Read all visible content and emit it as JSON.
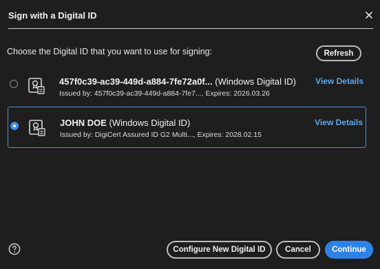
{
  "dialog": {
    "title": "Sign with a Digital ID",
    "close_icon": "close-icon"
  },
  "prompt": "Choose the Digital ID that you want to use for signing:",
  "refresh_label": "Refresh",
  "ids": [
    {
      "name": "457f0c39-ac39-449d-a884-7fe72a0f...",
      "kind": "(Windows Digital ID)",
      "issued": "Issued by: 457f0c39-ac39-449d-a884-7fe7..., Expires: 2026.03.26",
      "view_details": "View Details",
      "selected": false
    },
    {
      "name": "JOHN DOE",
      "kind": "(Windows Digital ID)",
      "issued": "Issued by: DigiCert Assured ID G2 Multi..., Expires: 2028.02.15",
      "view_details": "View Details",
      "selected": true
    }
  ],
  "footer": {
    "help_icon": "help-icon",
    "configure_label": "Configure New Digital ID",
    "cancel_label": "Cancel",
    "continue_label": "Continue"
  },
  "colors": {
    "background": "#1e1e1e",
    "accent": "#2d82e6",
    "link": "#5ba8f0",
    "selection_border": "#4f8fd8"
  }
}
